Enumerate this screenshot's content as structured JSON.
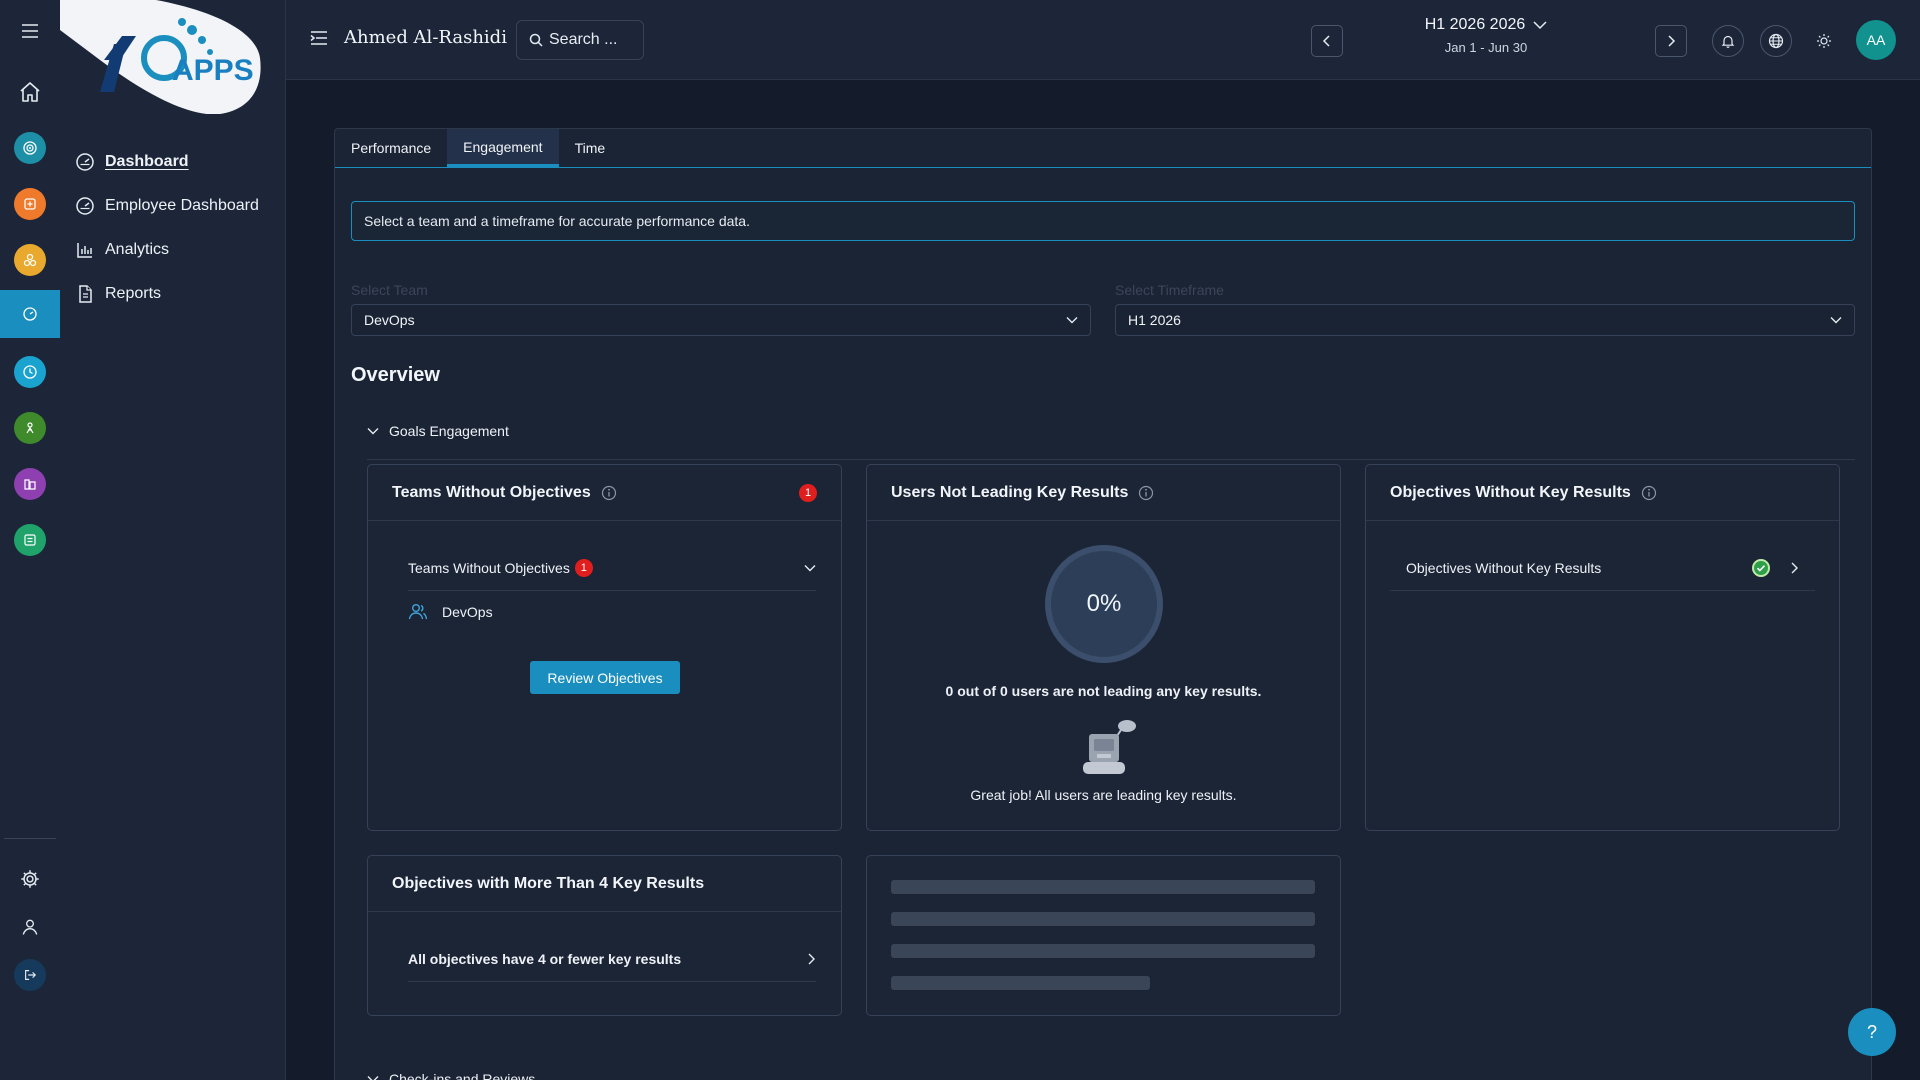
{
  "brand": {
    "logo_text": "APPS",
    "colors": {
      "accent": "#1a8fbf",
      "background": "#141c2b",
      "panel": "#1c2638",
      "badge": "#e01e1e",
      "avatar": "#12928f"
    }
  },
  "rail": {
    "items": [
      {
        "name": "menu-icon"
      },
      {
        "name": "home-icon"
      },
      {
        "name": "objectives-app-icon",
        "color": "#1d8fa6"
      },
      {
        "name": "tasks-app-icon",
        "color": "#f07a2b"
      },
      {
        "name": "recognition-app-icon",
        "color": "#e8a92e"
      },
      {
        "name": "dashboard-app-icon",
        "color": "#1a8fbf",
        "active": true
      },
      {
        "name": "time-app-icon",
        "color": "#1aa3cf"
      },
      {
        "name": "wellbeing-app-icon",
        "color": "#3f8a2a"
      },
      {
        "name": "learning-app-icon",
        "color": "#8e3fb0"
      },
      {
        "name": "surveys-app-icon",
        "color": "#1fa36a"
      }
    ],
    "bottom": [
      "settings-icon",
      "user-icon",
      "logout-icon"
    ]
  },
  "sidenav": {
    "items": [
      {
        "label": "Dashboard",
        "icon": "gauge-icon",
        "active": true
      },
      {
        "label": "Employee Dashboard",
        "icon": "gauge-icon"
      },
      {
        "label": "Analytics",
        "icon": "bar-chart-icon"
      },
      {
        "label": "Reports",
        "icon": "document-icon"
      }
    ]
  },
  "header": {
    "user_name": "Ahmed Al-Rashidi",
    "search_placeholder": "Search ...",
    "period_title": "H1 2026 2026",
    "period_range": "Jan 1 - Jun 30",
    "avatar_initials": "AA"
  },
  "tabs": [
    {
      "label": "Performance"
    },
    {
      "label": "Engagement",
      "active": true
    },
    {
      "label": "Time"
    }
  ],
  "info_message": "Select a team and a timeframe for accurate performance data.",
  "filters": {
    "team": {
      "label": "Select Team",
      "value": "DevOps"
    },
    "timeframe": {
      "label": "Select Timeframe",
      "value": "H1 2026"
    }
  },
  "overview_title": "Overview",
  "sections": {
    "goals_engagement": "Goals Engagement",
    "checkins": "Check-ins and Reviews"
  },
  "cards": {
    "teams_without_objectives": {
      "title": "Teams Without Objectives",
      "badge": "1",
      "row_label": "Teams Without Objectives",
      "row_badge": "1",
      "team": "DevOps",
      "button": "Review Objectives"
    },
    "users_not_leading": {
      "title": "Users Not Leading Key Results",
      "percent": 0,
      "percent_label": "0%",
      "summary": "0 out of 0 users are not leading any key results.",
      "message": "Great job! All users are leading key results."
    },
    "objectives_without_kr": {
      "title": "Objectives Without Key Results",
      "row_label": "Objectives Without Key Results",
      "status": "check-icon"
    },
    "objectives_more_than_4": {
      "title": "Objectives with More Than 4 Key Results",
      "row_label": "All objectives have 4 or fewer key results"
    }
  },
  "help_label": "?"
}
